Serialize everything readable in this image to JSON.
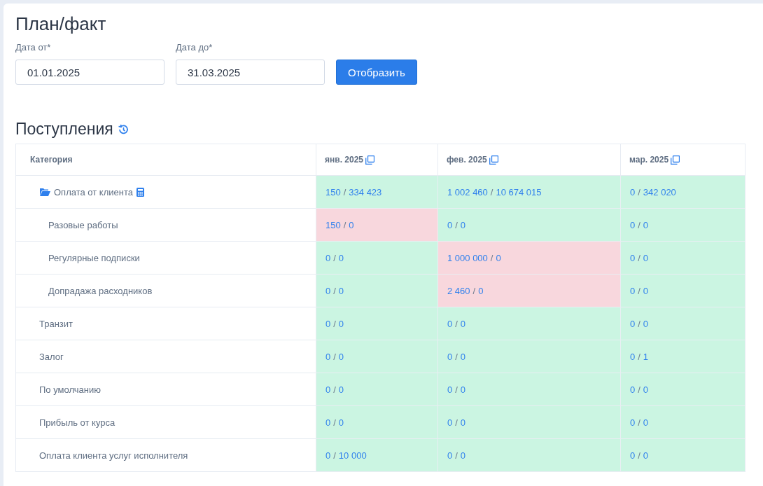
{
  "title": "План/факт",
  "filters": [
    {
      "label": "Дата от*",
      "value": "01.01.2025"
    },
    {
      "label": "Дата до*",
      "value": "31.03.2025"
    }
  ],
  "submit_button": "Отобразить",
  "section": {
    "title": "Поступления"
  },
  "table": {
    "category_header": "Категория",
    "month_columns": [
      "янв. 2025",
      "фев. 2025",
      "мар. 2025"
    ],
    "rows": [
      {
        "kind": "folder",
        "name": "Оплата от клиента",
        "cells": [
          {
            "plan": "150",
            "separator": "/",
            "fact": "334 423",
            "over_plan": false
          },
          {
            "plan": "1 002 460",
            "separator": "/",
            "fact": "10 674 015",
            "over_plan": false
          },
          {
            "plan": "0",
            "separator": "/",
            "fact": "342 020",
            "over_plan": false
          }
        ],
        "children": [
          {
            "kind": "item",
            "name": "Разовые работы",
            "cells": [
              {
                "plan": "150",
                "separator": "/",
                "fact": "0",
                "over_plan": true
              },
              {
                "plan": "0",
                "separator": "/",
                "fact": "0",
                "over_plan": false
              },
              {
                "plan": "0",
                "separator": "/",
                "fact": "0",
                "over_plan": false
              }
            ]
          },
          {
            "kind": "item",
            "name": "Регулярные подписки",
            "cells": [
              {
                "plan": "0",
                "separator": "/",
                "fact": "0",
                "over_plan": false
              },
              {
                "plan": "1 000 000",
                "separator": "/",
                "fact": "0",
                "over_plan": true
              },
              {
                "plan": "0",
                "separator": "/",
                "fact": "0",
                "over_plan": false
              }
            ]
          },
          {
            "kind": "item",
            "name": "Допрадажа расходников",
            "cells": [
              {
                "plan": "0",
                "separator": "/",
                "fact": "0",
                "over_plan": false
              },
              {
                "plan": "2 460",
                "separator": "/",
                "fact": "0",
                "over_plan": true
              },
              {
                "plan": "0",
                "separator": "/",
                "fact": "0",
                "over_plan": false
              }
            ]
          }
        ]
      },
      {
        "kind": "item",
        "name": "Транзит",
        "cells": [
          {
            "plan": "0",
            "separator": "/",
            "fact": "0",
            "over_plan": false
          },
          {
            "plan": "0",
            "separator": "/",
            "fact": "0",
            "over_plan": false
          },
          {
            "plan": "0",
            "separator": "/",
            "fact": "0",
            "over_plan": false
          }
        ]
      },
      {
        "kind": "item",
        "name": "Залог",
        "cells": [
          {
            "plan": "0",
            "separator": "/",
            "fact": "0",
            "over_plan": false
          },
          {
            "plan": "0",
            "separator": "/",
            "fact": "0",
            "over_plan": false
          },
          {
            "plan": "0",
            "separator": "/",
            "fact": "1",
            "over_plan": false
          }
        ]
      },
      {
        "kind": "item",
        "name": "По умолчанию",
        "cells": [
          {
            "plan": "0",
            "separator": "/",
            "fact": "0",
            "over_plan": false
          },
          {
            "plan": "0",
            "separator": "/",
            "fact": "0",
            "over_plan": false
          },
          {
            "plan": "0",
            "separator": "/",
            "fact": "0",
            "over_plan": false
          }
        ]
      },
      {
        "kind": "item",
        "name": "Прибыль от курса",
        "cells": [
          {
            "plan": "0",
            "separator": "/",
            "fact": "0",
            "over_plan": false
          },
          {
            "plan": "0",
            "separator": "/",
            "fact": "0",
            "over_plan": false
          },
          {
            "plan": "0",
            "separator": "/",
            "fact": "0",
            "over_plan": false
          }
        ]
      },
      {
        "kind": "item",
        "name": "Оплата клиента услуг исполнителя",
        "cells": [
          {
            "plan": "0",
            "separator": "/",
            "fact": "10 000",
            "over_plan": false
          },
          {
            "plan": "0",
            "separator": "/",
            "fact": "0",
            "over_plan": false
          },
          {
            "plan": "0",
            "separator": "/",
            "fact": "0",
            "over_plan": false
          }
        ]
      }
    ]
  }
}
